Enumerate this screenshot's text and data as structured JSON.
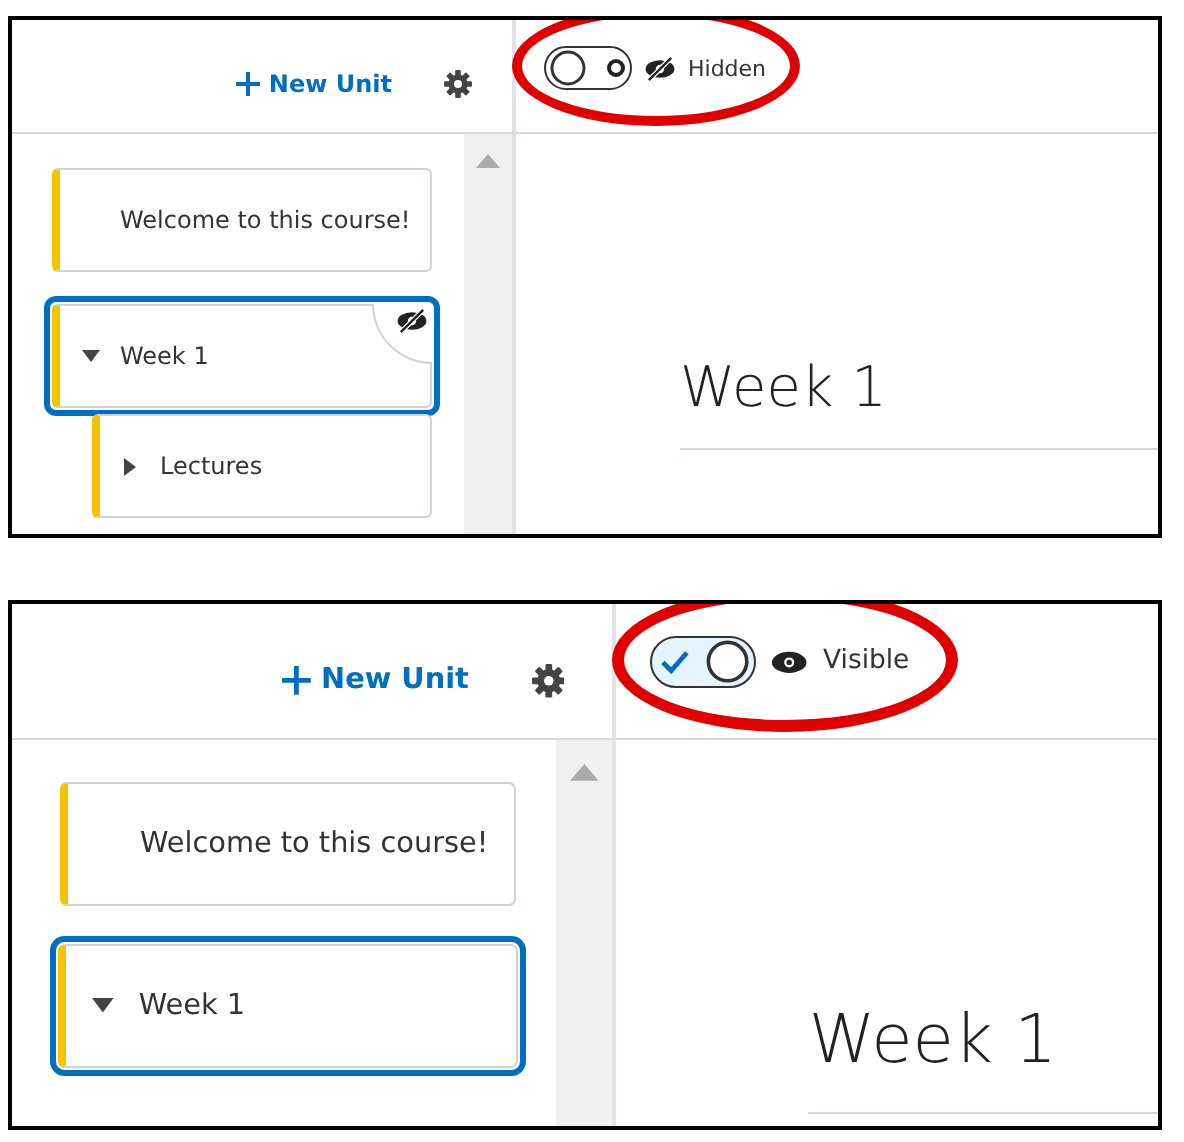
{
  "panels": [
    {
      "new_unit": "New Unit",
      "visibility": {
        "on": false,
        "label": "Hidden"
      },
      "units": [
        {
          "title": "Welcome to this course!",
          "selected": false,
          "hidden": false
        },
        {
          "title": "Week 1",
          "selected": true,
          "hidden": true,
          "expanded": true,
          "children": [
            {
              "title": "Lectures",
              "selected": false,
              "hidden": false,
              "expanded": false
            }
          ]
        }
      ],
      "heading": "Week 1"
    },
    {
      "new_unit": "New Unit",
      "visibility": {
        "on": true,
        "label": "Visible"
      },
      "units": [
        {
          "title": "Welcome to this course!",
          "selected": false,
          "hidden": false
        },
        {
          "title": "Week 1",
          "selected": true,
          "hidden": false,
          "expanded": true
        }
      ],
      "heading": "Week 1"
    }
  ]
}
